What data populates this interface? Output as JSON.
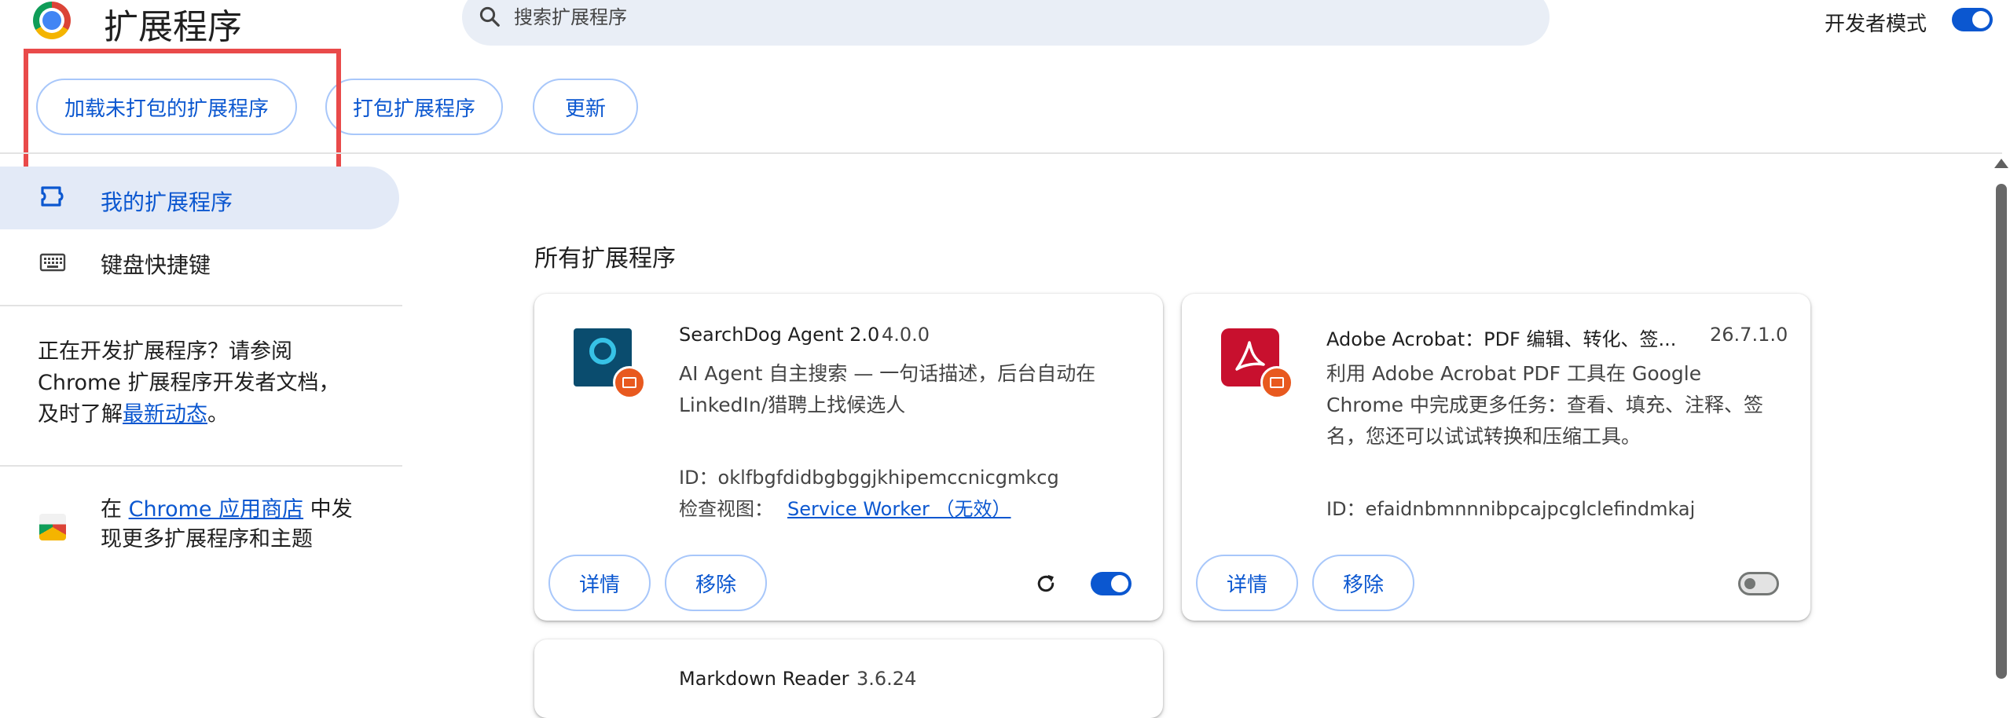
{
  "header": {
    "title": "扩展程序",
    "search_placeholder": "搜索扩展程序",
    "dev_mode_label": "开发者模式",
    "dev_mode_on": true
  },
  "toolbar": {
    "load_unpacked": "加载未打包的扩展程序",
    "pack_extension": "打包扩展程序",
    "update": "更新"
  },
  "sidebar": {
    "items": [
      {
        "label": "我的扩展程序",
        "icon": "extension-icon",
        "active": true
      },
      {
        "label": "键盘快捷键",
        "icon": "keyboard-icon",
        "active": false
      }
    ],
    "dev_note_prefix": "正在开发扩展程序？请参阅 Chrome 扩展程序开发者文档，及时了解",
    "dev_note_link": "最新动态",
    "dev_note_suffix": "。",
    "store_prefix": "在 ",
    "store_link": "Chrome 应用商店",
    "store_suffix": " 中发现更多扩展程序和主题"
  },
  "main": {
    "section_title": "所有扩展程序",
    "extensions": [
      {
        "name": "SearchDog Agent 2.0",
        "version": "4.0.0",
        "description": "AI Agent 自主搜索 — 一句话描述，后台自动在 LinkedIn/猎聘上找候选人",
        "id_text": "ID：oklfbgfdidbgbggjkhipemccnicgmkcg",
        "inspect_label": "检查视图：",
        "inspect_link": "Service Worker （无效）",
        "details": "详情",
        "remove": "移除",
        "enabled": true
      },
      {
        "name": "Adobe Acrobat：PDF 编辑、转化、签...",
        "version": "26.7.1.0",
        "description": "利用 Adobe Acrobat PDF 工具在 Google Chrome 中完成更多任务：查看、填充、注释、签名，您还可以试试转换和压缩工具。",
        "id_text": "ID：efaidnbmnnnibpcajpcglclefindmkaj",
        "details": "详情",
        "remove": "移除",
        "enabled": false
      },
      {
        "name": "Markdown Reader",
        "version": "3.6.24"
      }
    ]
  },
  "colors": {
    "accent": "#0b57d0",
    "highlight_box": "#e94a4a",
    "active_nav_bg": "#e3eaf7"
  }
}
